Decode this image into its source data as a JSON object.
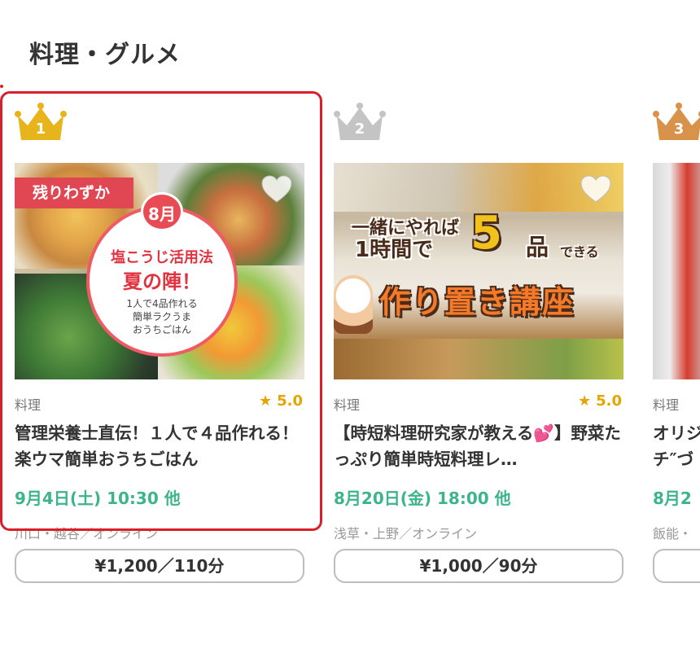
{
  "section": {
    "title": "料理・グルメ"
  },
  "cards": [
    {
      "rank": "1",
      "crown_color": "#e8b41c",
      "badge": "残りわずか",
      "image_text": {
        "month": "8月",
        "line1": "塩こうじ活用法",
        "line2": "夏の陣！",
        "line3": "1人で4品作れる",
        "line4": "簡単ラクうま",
        "line5": "おうちごはん"
      },
      "category": "料理",
      "rating": "5.0",
      "title": "管理栄養士直伝！１人で４品作れる！楽ウマ簡単おうちごはん",
      "date": "9月4日(土) 10:30 他",
      "area": "川口・越谷／オンライン",
      "price": "¥1,200／110分"
    },
    {
      "rank": "2",
      "crown_color": "#c4c4c4",
      "image_text": {
        "line1": "一緒にやれば",
        "line2": "1時間で",
        "big_number": "5",
        "line3": "品",
        "line4": "できる",
        "headline": "作り置き講座"
      },
      "category": "料理",
      "rating": "5.0",
      "title": "【時短料理研究家が教える💕】野菜たっぷり簡単時短料理レ…",
      "date": "8月20日(金) 18:00 他",
      "area": "浅草・上野／オンライン",
      "price": "¥1,000／90分"
    },
    {
      "rank": "3",
      "crown_color": "#d9924a",
      "category": "料理",
      "title": "オリジ チ″づ",
      "date": "8月2",
      "area": "飯能・"
    }
  ],
  "colors": {
    "highlight": "#d9202a",
    "date": "#3cb48c",
    "star": "#e5a400"
  },
  "icons": {
    "favorite": "heart-icon",
    "rank": "crown-icon",
    "rating": "star-icon"
  }
}
